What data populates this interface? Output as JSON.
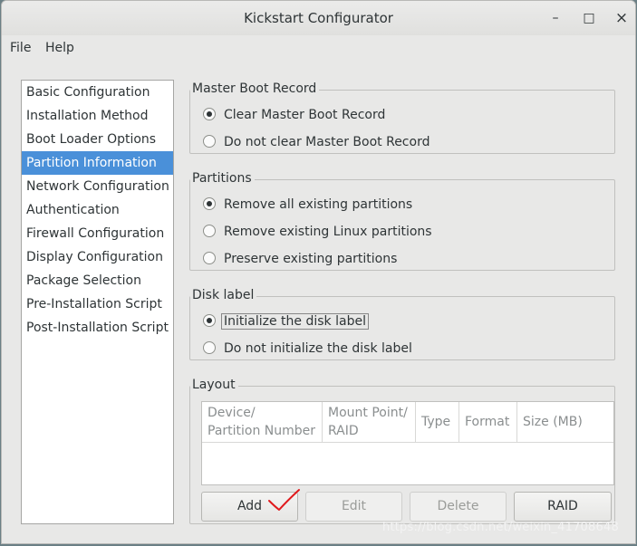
{
  "window": {
    "title": "Kickstart Configurator",
    "controls": [
      "–",
      "□",
      "×"
    ]
  },
  "menu": [
    "File",
    "Help"
  ],
  "sidebar": {
    "items": [
      {
        "label": "Basic Configuration"
      },
      {
        "label": "Installation Method"
      },
      {
        "label": "Boot Loader Options"
      },
      {
        "label": "Partition Information",
        "selected": true
      },
      {
        "label": "Network Configuration"
      },
      {
        "label": "Authentication"
      },
      {
        "label": "Firewall Configuration"
      },
      {
        "label": "Display Configuration"
      },
      {
        "label": "Package Selection"
      },
      {
        "label": "Pre-Installation Script"
      },
      {
        "label": "Post-Installation Script"
      }
    ]
  },
  "mbr": {
    "title": "Master Boot Record",
    "options": [
      "Clear Master Boot Record",
      "Do not clear Master Boot Record"
    ],
    "selected": 0
  },
  "partitions": {
    "title": "Partitions",
    "options": [
      "Remove all existing partitions",
      "Remove existing Linux partitions",
      "Preserve existing partitions"
    ],
    "selected": 0
  },
  "disk_label": {
    "title": "Disk label",
    "options": [
      "Initialize the disk label",
      "Do not initialize the disk label"
    ],
    "selected": 0
  },
  "layout": {
    "title": "Layout",
    "columns": [
      "Device/\nPartition Number",
      "Mount Point/\nRAID",
      "Type",
      "Format",
      "Size (MB)"
    ],
    "rows": [],
    "buttons": {
      "add": {
        "label": "Add",
        "enabled": true
      },
      "edit": {
        "label": "Edit",
        "enabled": false
      },
      "delete": {
        "label": "Delete",
        "enabled": false
      },
      "raid": {
        "label": "RAID",
        "enabled": true
      }
    }
  },
  "watermark": "https://blog.csdn.net/weixin_41708648"
}
